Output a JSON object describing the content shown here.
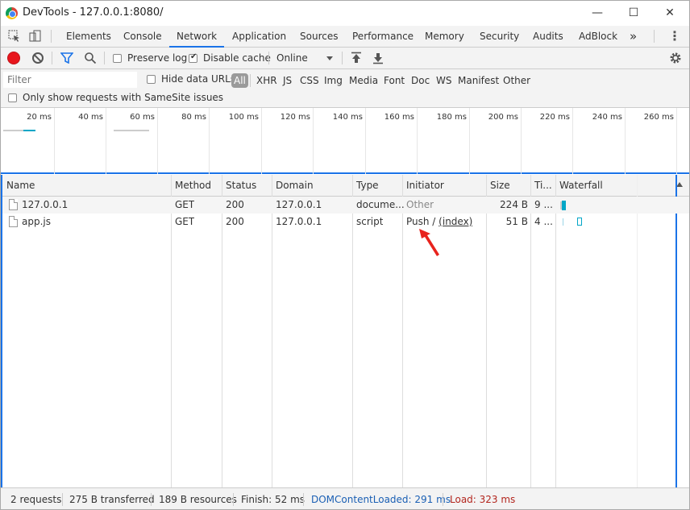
{
  "window": {
    "title": "DevTools - 127.0.0.1:8080/",
    "minimize": "—",
    "maximize": "☐",
    "close": "✕"
  },
  "tabs": [
    "Elements",
    "Console",
    "Network",
    "Application",
    "Sources",
    "Performance",
    "Memory",
    "Security",
    "Audits",
    "AdBlock"
  ],
  "active_tab": "Network",
  "more_tabs": "»",
  "kebab": "⋮",
  "toolbar": {
    "preserve_log": "Preserve log",
    "preserve_log_checked": false,
    "disable_cache": "Disable cache",
    "disable_cache_checked": true,
    "throttle": "Online"
  },
  "filter": {
    "placeholder": "Filter",
    "hide_data_urls": "Hide data URLs",
    "types": [
      "All",
      "XHR",
      "JS",
      "CSS",
      "Img",
      "Media",
      "Font",
      "Doc",
      "WS",
      "Manifest",
      "Other"
    ],
    "samesite": "Only show requests with SameSite issues"
  },
  "overview": {
    "ticks": [
      "20 ms",
      "40 ms",
      "60 ms",
      "80 ms",
      "100 ms",
      "120 ms",
      "140 ms",
      "160 ms",
      "180 ms",
      "200 ms",
      "220 ms",
      "240 ms",
      "260 ms"
    ]
  },
  "columns": [
    "Name",
    "Method",
    "Status",
    "Domain",
    "Type",
    "Initiator",
    "Size",
    "Ti...",
    "Waterfall"
  ],
  "rows": [
    {
      "name": "127.0.0.1",
      "method": "GET",
      "status": "200",
      "domain": "127.0.0.1",
      "type": "docume...",
      "initiator": "Other",
      "initiator_link": "",
      "size": "224 B",
      "time": "9 ..."
    },
    {
      "name": "app.js",
      "method": "GET",
      "status": "200",
      "domain": "127.0.0.1",
      "type": "script",
      "initiator": "Push / ",
      "initiator_link": "(index)",
      "size": "51 B",
      "time": "4 ..."
    }
  ],
  "status": {
    "requests": "2 requests",
    "transferred": "275 B transferred",
    "resources": "189 B resources",
    "finish": "Finish: 52 ms",
    "dcl": "DOMContentLoaded: 291 ms",
    "load": "Load: 323 ms"
  },
  "colors": {
    "accent": "#1a73e8",
    "record": "#e8161d",
    "dcl": "#1a5fb4",
    "load": "#b3261e",
    "waterfall": "#00a6c7"
  }
}
